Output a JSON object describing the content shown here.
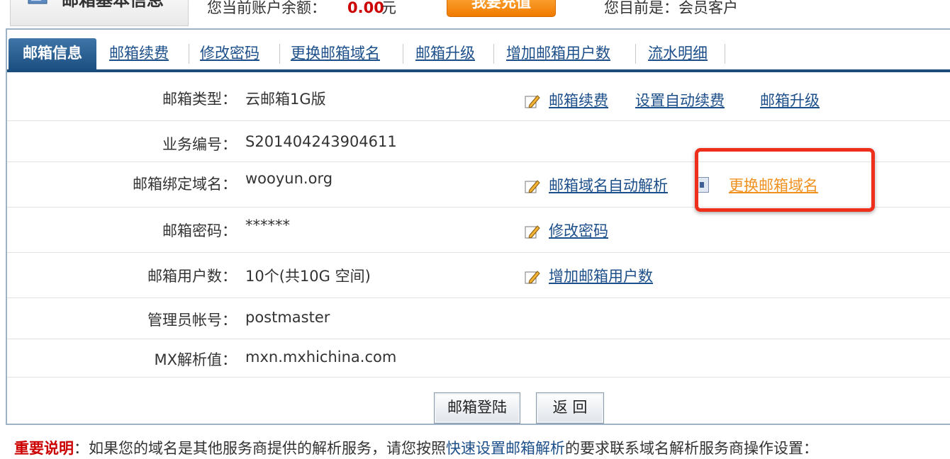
{
  "header": {
    "title": "邮箱基本信息",
    "balance_label": "您当前账户余额：",
    "balance_amount": "0.00",
    "balance_unit": "元",
    "recharge_button": "我要充值",
    "member_status": "您目前是：会员客户"
  },
  "tabs": {
    "active": "邮箱信息",
    "items": [
      "邮箱续费",
      "修改密码",
      "更换邮箱域名",
      "邮箱升级",
      "增加邮箱用户数",
      "流水明细"
    ]
  },
  "rows": [
    {
      "label": "邮箱类型：",
      "value": "云邮箱1G版",
      "links": [
        "邮箱续费",
        "设置自动续费",
        "邮箱升级"
      ]
    },
    {
      "label": "业务编号：",
      "value": "S201404243904611"
    },
    {
      "label": "邮箱绑定域名：",
      "value": "wooyun.org",
      "links": [
        "邮箱域名自动解析",
        "更换邮箱域名"
      ]
    },
    {
      "label": "邮箱密码：",
      "value": "******",
      "links": [
        "修改密码"
      ]
    },
    {
      "label": "邮箱用户数：",
      "value": "10个(共10G 空间)",
      "links": [
        "增加邮箱用户数"
      ]
    },
    {
      "label": "管理员帐号：",
      "value": "postmaster"
    },
    {
      "label": "MX解析值：",
      "value": "mxn.mxhichina.com"
    }
  ],
  "buttons": {
    "login": "邮箱登陆",
    "back": "返 回"
  },
  "notice": {
    "prefix": "重要说明",
    "text1": "：如果您的域名是其他服务商提供的解析服务，请您按照",
    "link": "快速设置邮箱解析",
    "text2": "的要求联系域名解析服务商操作设置："
  },
  "colors": {
    "tab_active_bg": "#1b4e80",
    "link": "#1c4f8a",
    "highlight_link": "#f0901e",
    "highlight_box": "#ee2f1c",
    "balance": "#cc0000"
  }
}
